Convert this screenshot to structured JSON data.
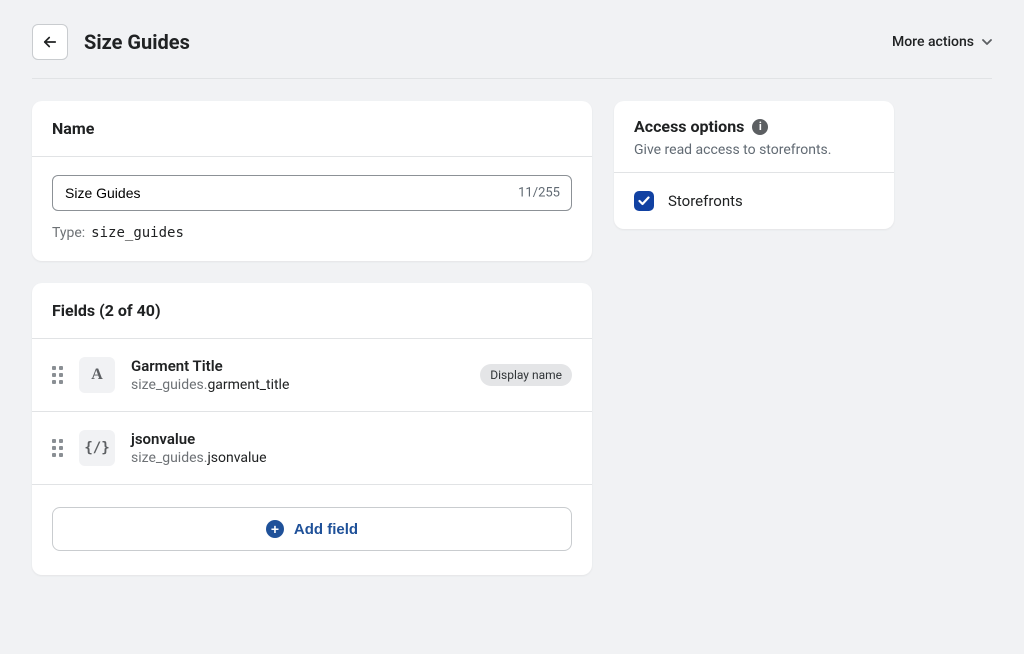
{
  "header": {
    "title": "Size Guides",
    "more_actions": "More actions"
  },
  "name_card": {
    "header": "Name",
    "value": "Size Guides",
    "char_count": "11/255",
    "type_label": "Type:",
    "type_value": "size_guides"
  },
  "fields_card": {
    "header": "Fields (2 of 40)",
    "fields": [
      {
        "icon": "A",
        "title": "Garment Title",
        "key_prefix": "size_guides.",
        "key_suffix": "garment_title",
        "badge": "Display name"
      },
      {
        "icon": "{/}",
        "title": "jsonvalue",
        "key_prefix": "size_guides.",
        "key_suffix": "jsonvalue",
        "badge": null
      }
    ],
    "add_field": "Add field"
  },
  "access_card": {
    "title": "Access options",
    "subtitle": "Give read access to storefronts.",
    "option_label": "Storefronts",
    "option_checked": true
  }
}
